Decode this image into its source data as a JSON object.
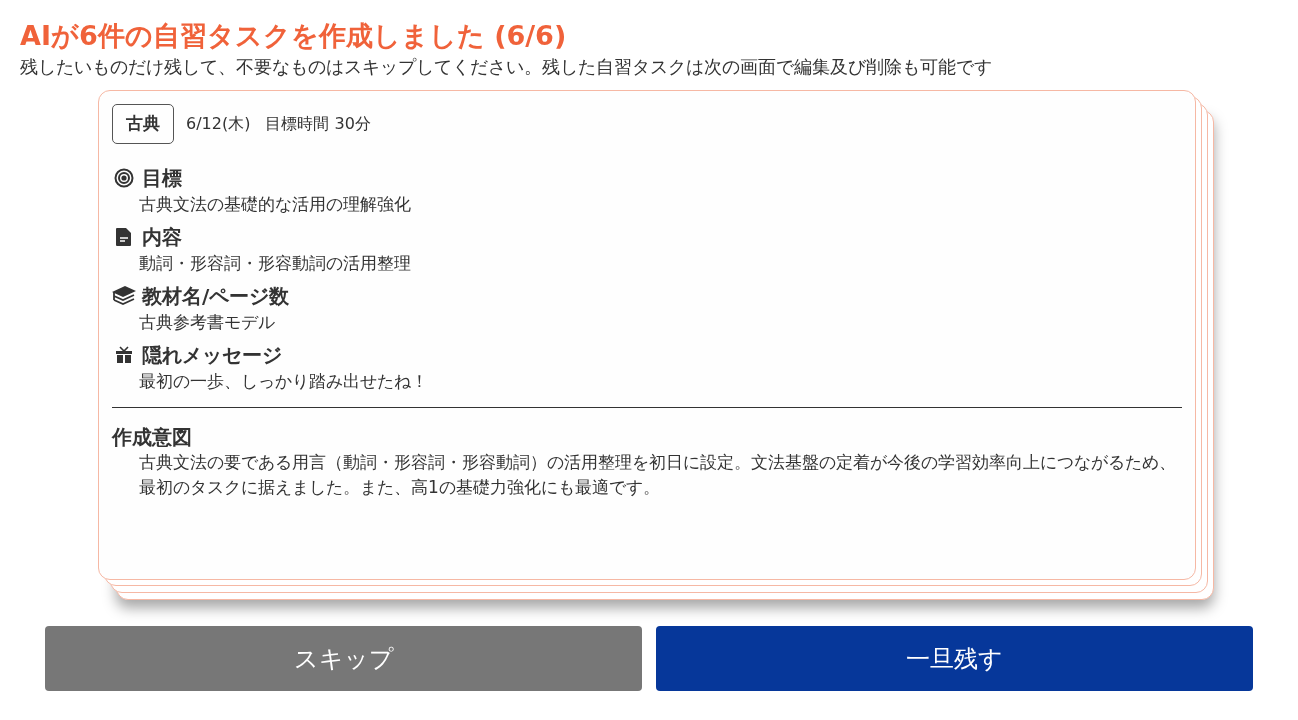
{
  "title": "AIが6件の自習タスクを作成しました (6/6)",
  "subtitle": "残したいものだけ残して、不要なものはスキップしてください。残した自習タスクは次の画面で編集及び削除も可能です",
  "card": {
    "subject": "古典",
    "date": "6/12(木)",
    "target_time": "目標時間 30分",
    "sections": [
      {
        "kind": "target",
        "heading": "目標",
        "body": "古典文法の基礎的な活用の理解強化"
      },
      {
        "kind": "document",
        "heading": "内容",
        "body": "動詞・形容詞・形容動詞の活用整理"
      },
      {
        "kind": "books",
        "heading": "教材名/ページ数",
        "body": "古典参考書モデル"
      },
      {
        "kind": "gift",
        "heading": "隠れメッセージ",
        "body": "最初の一歩、しっかり踏み出せたね！"
      }
    ],
    "intent": {
      "heading": "作成意図",
      "body": "古典文法の要である用言（動詞・形容詞・形容動詞）の活用整理を初日に設定。文法基盤の定着が今後の学習効率向上につながるため、最初のタスクに据えました。また、高1の基礎力強化にも最適です。"
    }
  },
  "buttons": [
    {
      "kind": "skip",
      "label": "スキップ"
    },
    {
      "kind": "keep",
      "label": "一旦残す"
    }
  ]
}
